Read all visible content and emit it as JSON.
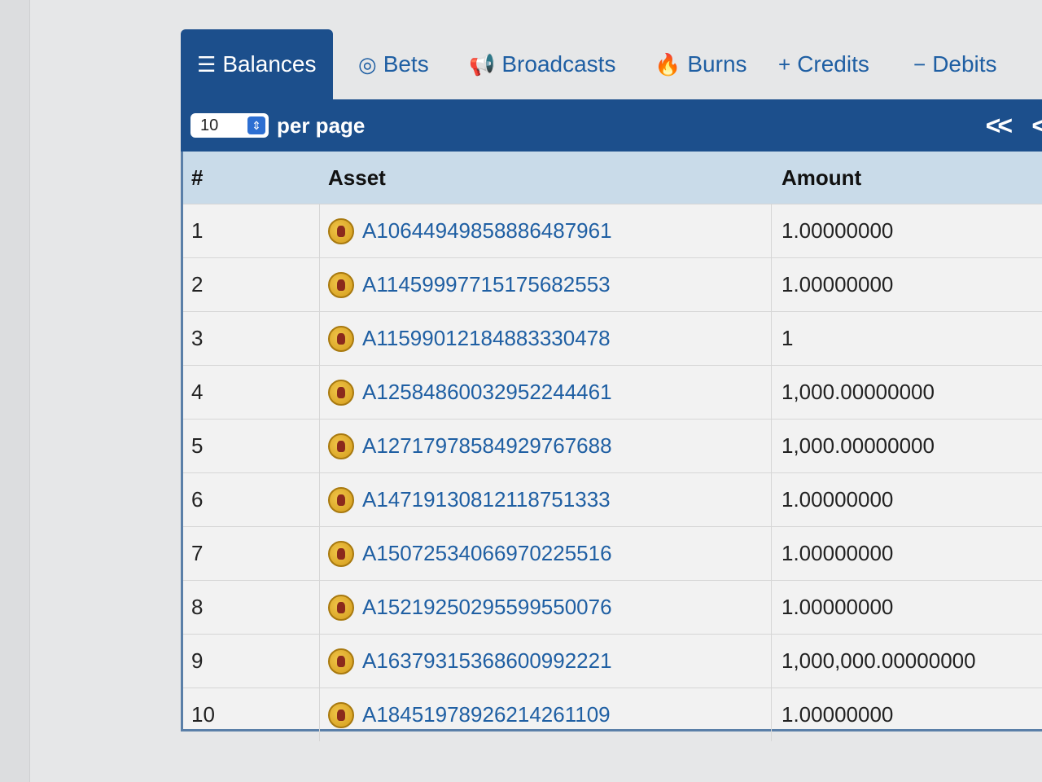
{
  "tabs": [
    {
      "label": "Balances",
      "icon": "list-icon",
      "active": true
    },
    {
      "label": "Bets",
      "icon": "target-icon",
      "active": false
    },
    {
      "label": "Broadcasts",
      "icon": "megaphone-icon",
      "active": false
    },
    {
      "label": "Burns",
      "icon": "flame-icon",
      "active": false
    },
    {
      "label": "Credits",
      "icon": "plus-icon",
      "active": false
    },
    {
      "label": "Debits",
      "icon": "minus-icon",
      "active": false
    }
  ],
  "toolbar": {
    "per_page_value": "10",
    "per_page_label": "per page",
    "first_label": "<<",
    "prev_label": "<"
  },
  "table": {
    "headers": {
      "num": "#",
      "asset": "Asset",
      "amount": "Amount"
    },
    "rows": [
      {
        "num": "1",
        "asset": "A10644949858886487961",
        "amount": "1.00000000"
      },
      {
        "num": "2",
        "asset": "A11459997715175682553",
        "amount": "1.00000000"
      },
      {
        "num": "3",
        "asset": "A11599012184883330478",
        "amount": "1"
      },
      {
        "num": "4",
        "asset": "A12584860032952244461",
        "amount": "1,000.00000000"
      },
      {
        "num": "5",
        "asset": "A12717978584929767688",
        "amount": "1,000.00000000"
      },
      {
        "num": "6",
        "asset": "A14719130812118751333",
        "amount": "1.00000000"
      },
      {
        "num": "7",
        "asset": "A15072534066970225516",
        "amount": "1.00000000"
      },
      {
        "num": "8",
        "asset": "A15219250295599550076",
        "amount": "1.00000000"
      },
      {
        "num": "9",
        "asset": "A16379315368600992221",
        "amount": "1,000,000.00000000"
      },
      {
        "num": "10",
        "asset": "A18451978926214261109",
        "amount": "1.00000000"
      }
    ]
  },
  "colors": {
    "header_bar": "#1c4f8c",
    "link": "#1f5fa3",
    "table_header": "#c9dbe9"
  }
}
